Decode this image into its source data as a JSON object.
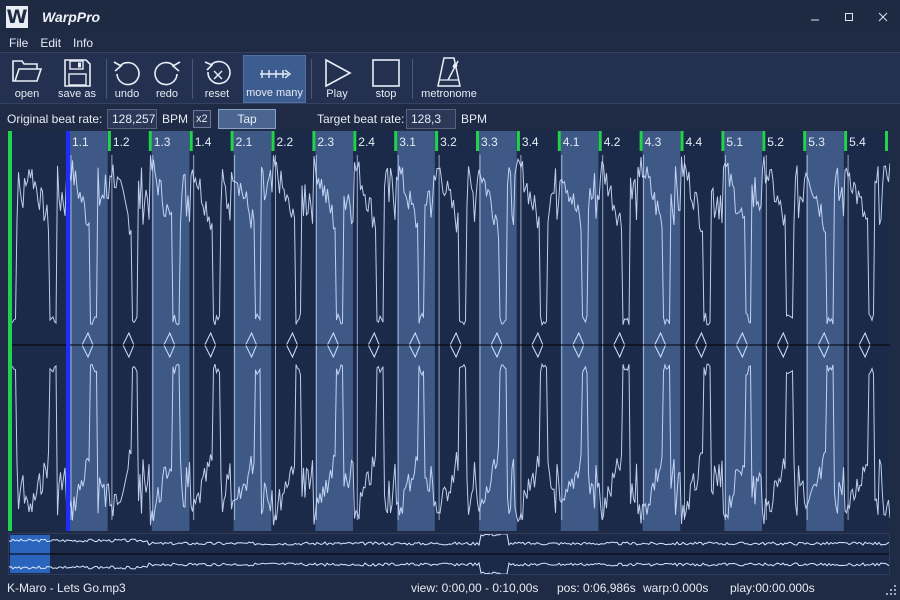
{
  "app": {
    "title": "WarpPro",
    "logo_letter": "W"
  },
  "window_controls": {
    "minimize": "–",
    "maximize": "☐",
    "close": "X"
  },
  "menu": [
    "File",
    "Edit",
    "Info"
  ],
  "toolbar": {
    "open": "open",
    "save_as": "save as",
    "undo": "undo",
    "redo": "redo",
    "reset": "reset",
    "move_many": "move many",
    "play": "Play",
    "stop": "stop",
    "metronome": "metronome",
    "active": "move many"
  },
  "rates": {
    "original_label": "Original beat rate:",
    "original_value": "128,257",
    "original_unit": "BPM",
    "x2_label": "x2",
    "tap_label": "Tap",
    "target_label": "Target beat rate:",
    "target_value": "128,3",
    "target_unit": "BPM"
  },
  "beat_markers": [
    "1.1",
    "1.2",
    "1.3",
    "1.4",
    "2.1",
    "2.2",
    "2.3",
    "2.4",
    "3.1",
    "3.2",
    "3.3",
    "3.4",
    "4.1",
    "4.2",
    "4.3",
    "4.4",
    "5.1",
    "5.2",
    "5.3",
    "5.4"
  ],
  "colors": {
    "waveform": "#cfe0ff",
    "highlight_band": "#5b7fb8",
    "marker_green": "#22d24a",
    "playhead_blue": "#1e2cff",
    "baseline": "#000000"
  },
  "status": {
    "file": "K-Maro - Lets Go.mp3",
    "view": "view: 0:00,00 - 0:10,00s",
    "pos": "pos: 0:06,986s",
    "warp": "warp:0.000s",
    "play": "play:00:00.000s"
  }
}
